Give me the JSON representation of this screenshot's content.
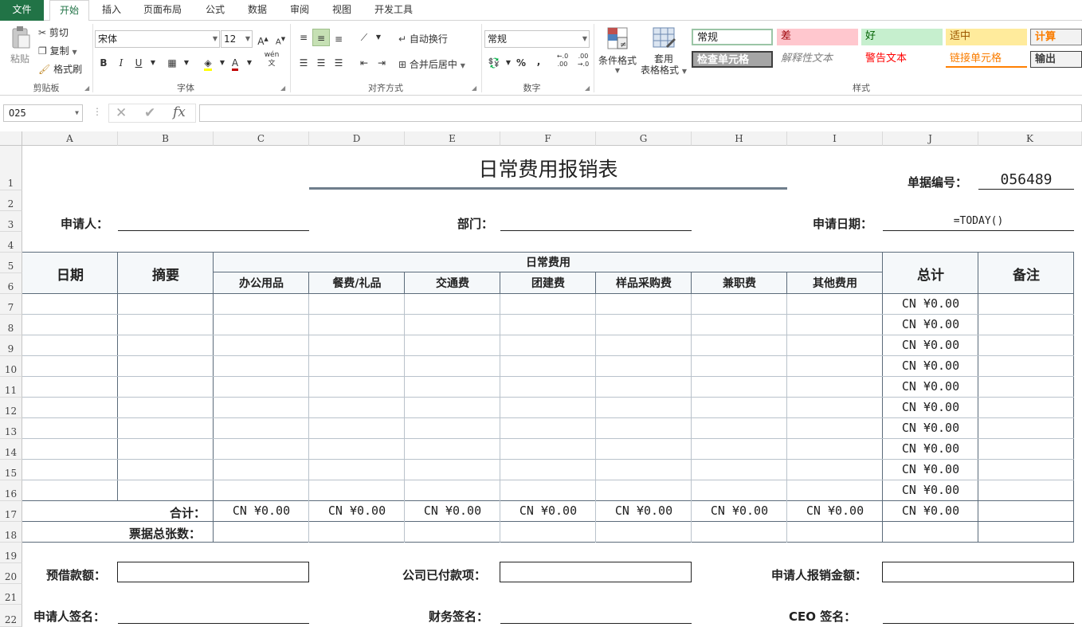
{
  "tabs": [
    "文件",
    "开始",
    "插入",
    "页面布局",
    "公式",
    "数据",
    "审阅",
    "视图",
    "开发工具"
  ],
  "clipboard": {
    "paste": "粘贴",
    "cut": "剪切",
    "copy": "复制",
    "format_painter": "格式刷",
    "label": "剪贴板"
  },
  "font": {
    "name": "宋体",
    "size": "12",
    "bold": "B",
    "italic": "I",
    "underline": "U",
    "grow": "A",
    "shrink": "A",
    "label": "字体",
    "color_a": "A",
    "wen": "wén"
  },
  "alignment": {
    "wrap": "自动换行",
    "merge": "合并后居中",
    "label": "对齐方式"
  },
  "number": {
    "format": "常规",
    "percent": "%",
    "comma": ",",
    "label": "数字",
    "dec_inc": "←.0 .00",
    "dec_dec": ".00 →.0"
  },
  "styles_group": {
    "conditional": "条件格式",
    "table_format": [
      "套用",
      "表格格式"
    ],
    "label": "样式",
    "cells": [
      {
        "text": "常规",
        "bg": "#ffffff",
        "color": "#000000"
      },
      {
        "text": "差",
        "bg": "#ffc7ce",
        "color": "#9c0006"
      },
      {
        "text": "好",
        "bg": "#c6efce",
        "color": "#006100"
      },
      {
        "text": "适中",
        "bg": "#ffeb9c",
        "color": "#9c5700"
      },
      {
        "text": "计算",
        "bg": "#f2f2f2",
        "color": "#fa7d00"
      },
      {
        "text": "检查单元格",
        "bg": "#a5a5a5",
        "color": "#ffffff"
      },
      {
        "text": "解释性文本",
        "bg": "#ffffff",
        "color": "#7f7f7f"
      },
      {
        "text": "警告文本",
        "bg": "#ffffff",
        "color": "#ff0000"
      },
      {
        "text": "链接单元格",
        "bg": "#ffffff",
        "color": "#fa7d00"
      },
      {
        "text": "输出",
        "bg": "#f2f2f2",
        "color": "#3f3f3f"
      }
    ]
  },
  "formula_bar": {
    "name_box": "O25",
    "fx": "fx",
    "value": ""
  },
  "columns": [
    "A",
    "B",
    "C",
    "D",
    "E",
    "F",
    "G",
    "H",
    "I",
    "J",
    "K"
  ],
  "rows": [
    "1",
    "2",
    "3",
    "4",
    "5",
    "6",
    "7",
    "8",
    "9",
    "10",
    "11",
    "12",
    "13",
    "14",
    "15",
    "16",
    "17",
    "18",
    "19",
    "20",
    "21",
    "22"
  ],
  "sheet": {
    "title": "日常费用报销表",
    "doc_no_label": "单据编号：",
    "doc_no": "056489",
    "applicant_label": "申请人：",
    "dept_label": "部门：",
    "date_label": "申请日期：",
    "date_value": "=TODAY()",
    "hdr_date": "日期",
    "hdr_summary": "摘要",
    "hdr_daily": "日常费用",
    "sub_headers": [
      "办公用品",
      "餐费/礼品",
      "交通费",
      "团建费",
      "样品采购费",
      "兼职费",
      "其他费用"
    ],
    "hdr_total": "总计",
    "hdr_note": "备注",
    "row_totals": [
      "CN ¥0.00",
      "CN ¥0.00",
      "CN ¥0.00",
      "CN ¥0.00",
      "CN ¥0.00",
      "CN ¥0.00",
      "CN ¥0.00",
      "CN ¥0.00",
      "CN ¥0.00",
      "CN ¥0.00"
    ],
    "sum_label": "合计：",
    "sum_values": [
      "CN ¥0.00",
      "CN ¥0.00",
      "CN ¥0.00",
      "CN ¥0.00",
      "CN ¥0.00",
      "CN ¥0.00",
      "CN ¥0.00",
      "CN ¥0.00"
    ],
    "ticket_label": "票据总张数：",
    "advance_label": "预借款额：",
    "paid_label": "公司已付款项：",
    "reimb_label": "申请人报销金额：",
    "sign_applicant": "申请人签名：",
    "sign_finance": "财务签名：",
    "sign_ceo": "CEO 签名："
  }
}
